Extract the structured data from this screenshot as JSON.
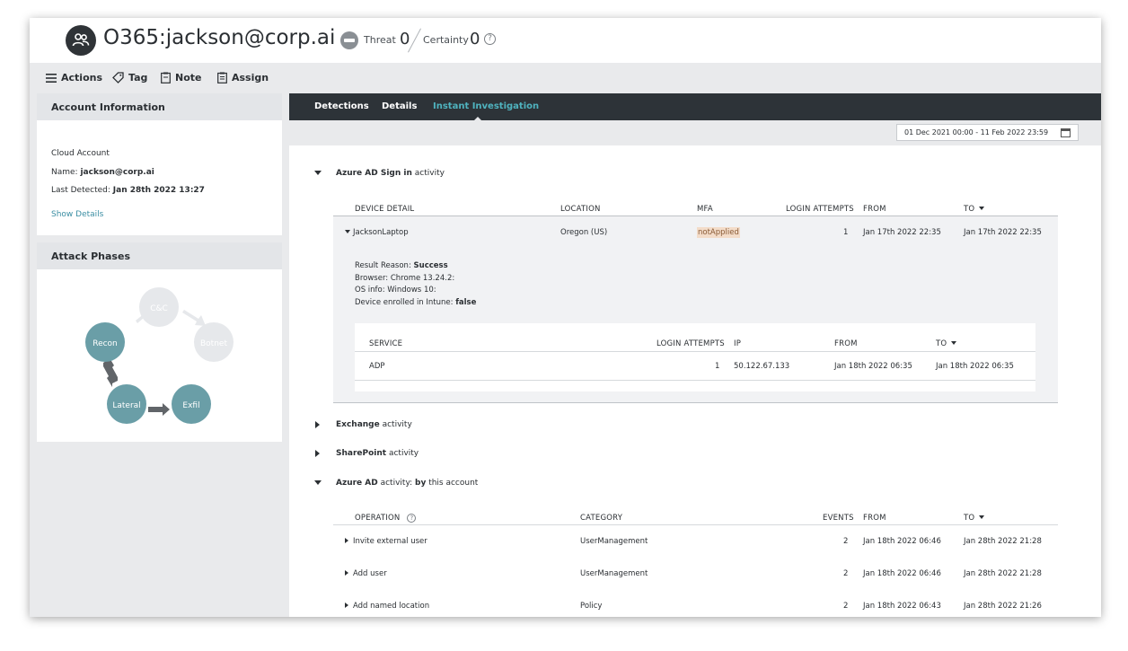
{
  "header": {
    "title": "O365:jackson@corp.ai",
    "threat_label": "Threat",
    "threat_value": "0",
    "certainty_label": "Certainty",
    "certainty_value": "0"
  },
  "toolbar": {
    "actions": "Actions",
    "tag": "Tag",
    "note": "Note",
    "assign": "Assign"
  },
  "account_info": {
    "heading": "Account Information",
    "type": "Cloud Account",
    "name_label": "Name:",
    "name_value": "jackson@corp.ai",
    "last_detected_label": "Last Detected:",
    "last_detected_value": "Jan 28th 2022 13:27",
    "show_details": "Show Details"
  },
  "attack_phases": {
    "heading": "Attack Phases",
    "nodes": {
      "cc": "C&C",
      "botnet": "Botnet",
      "recon": "Recon",
      "lateral": "Lateral",
      "exfil": "Exfil"
    },
    "active_color": "#6a9ea7",
    "inactive_color": "#e6e8eb"
  },
  "tabs": {
    "detections": "Detections",
    "details": "Details",
    "instant_investigation": "Instant Investigation"
  },
  "date_range": "01 Dec 2021 00:00 - 11 Feb 2022 23:59",
  "sign_in": {
    "section_bold": "Azure AD Sign in",
    "section_rest": " activity",
    "headers": {
      "device": "DEVICE DETAIL",
      "location": "LOCATION",
      "mfa": "MFA",
      "login_attempts": "LOGIN ATTEMPTS",
      "from": "FROM",
      "to": "TO"
    },
    "row": {
      "device": "JacksonLaptop",
      "location": "Oregon (US)",
      "mfa": "notApplied",
      "login_attempts": "1",
      "from": "Jan 17th 2022 22:35",
      "to": "Jan 17th 2022 22:35"
    },
    "details": {
      "result_label": "Result Reason:",
      "result_value": "Success",
      "browser": "Browser: Chrome 13.24.2:",
      "os": "OS info: Windows 10:",
      "intune_label": "Device enrolled in Intune:",
      "intune_value": "false"
    },
    "service_table": {
      "headers": {
        "service": "SERVICE",
        "login_attempts": "LOGIN ATTEMPTS",
        "ip": "IP",
        "from": "FROM",
        "to": "TO"
      },
      "row": {
        "service": "ADP",
        "login_attempts": "1",
        "ip": "50.122.67.133",
        "from": "Jan 18th 2022 06:35",
        "to": "Jan 18th 2022 06:35"
      }
    }
  },
  "exchange": {
    "bold": "Exchange",
    "rest": " activity"
  },
  "sharepoint": {
    "bold": "SharePoint",
    "rest": " activity"
  },
  "azure_ad": {
    "section_bold1": "Azure AD",
    "section_mid": " activity: ",
    "section_bold2": "by",
    "section_rest": " this account",
    "headers": {
      "operation": "OPERATION",
      "category": "CATEGORY",
      "events": "EVENTS",
      "from": "FROM",
      "to": "TO"
    },
    "rows": [
      {
        "operation": "Invite external user",
        "category": "UserManagement",
        "events": "2",
        "from": "Jan 18th 2022 06:46",
        "to": "Jan 28th 2022 21:28"
      },
      {
        "operation": "Add user",
        "category": "UserManagement",
        "events": "2",
        "from": "Jan 18th 2022 06:46",
        "to": "Jan 28th 2022 21:28"
      },
      {
        "operation": "Add named location",
        "category": "Policy",
        "events": "2",
        "from": "Jan 18th 2022 06:43",
        "to": "Jan 28th 2022 21:26"
      }
    ]
  }
}
